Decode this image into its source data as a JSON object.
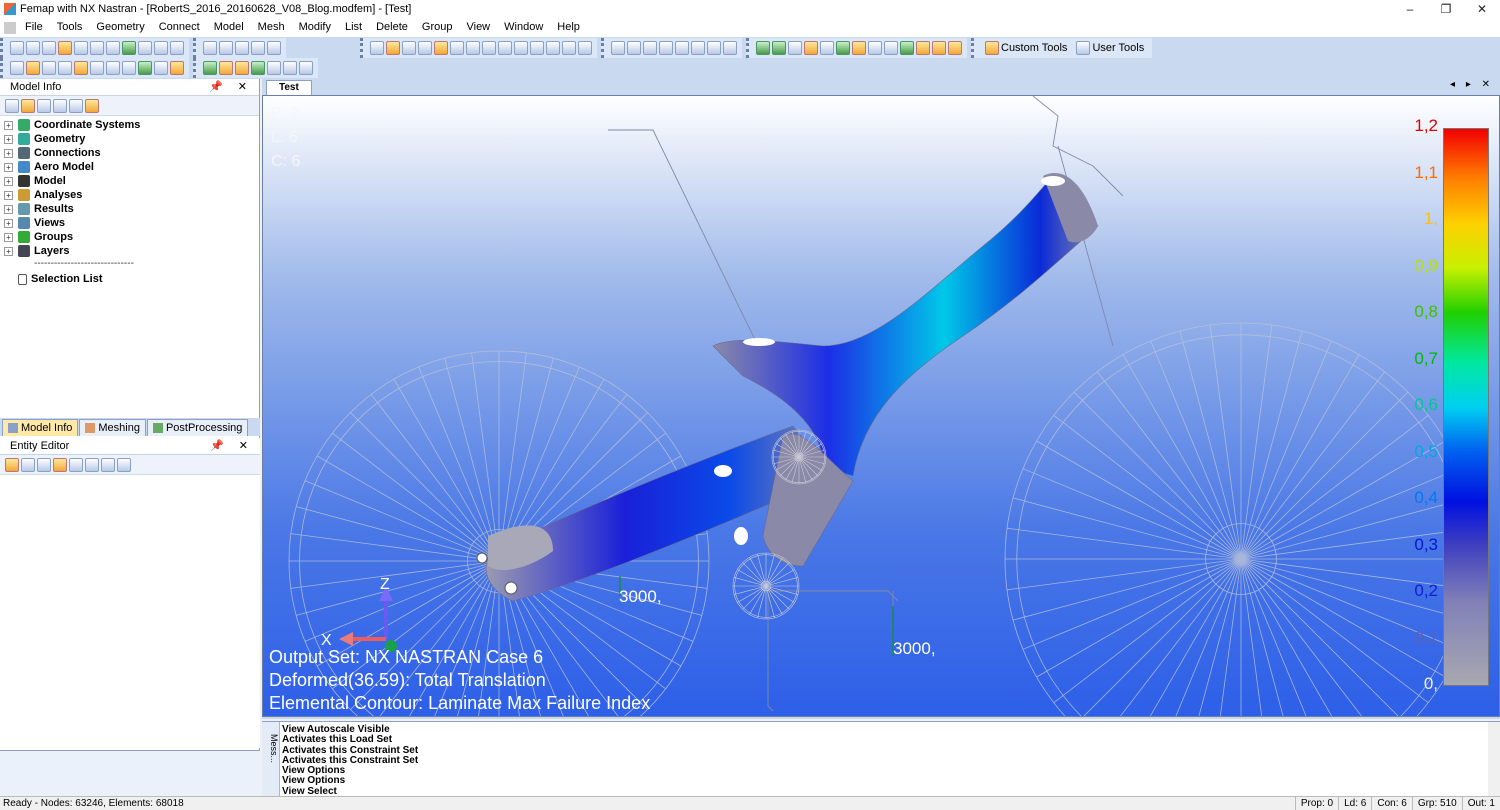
{
  "window": {
    "title": "Femap with NX Nastran - [RobertS_2016_20160628_V08_Blog.modfem] - [Test]",
    "controls": {
      "minimize": "–",
      "maximize": "❐",
      "close": "✕"
    }
  },
  "menu": [
    "File",
    "Tools",
    "Geometry",
    "Connect",
    "Model",
    "Mesh",
    "Modify",
    "List",
    "Delete",
    "Group",
    "View",
    "Window",
    "Help"
  ],
  "toolbar": {
    "custom_tools": "Custom Tools",
    "user_tools": "User Tools"
  },
  "model_info": {
    "title": "Model Info",
    "pane_buttons": "📌 ✕",
    "tree": [
      {
        "label": "Coordinate Systems",
        "color": "#3a6"
      },
      {
        "label": "Geometry",
        "color": "#3a9"
      },
      {
        "label": "Connections",
        "color": "#567"
      },
      {
        "label": "Aero Model",
        "color": "#48c"
      },
      {
        "label": "Model",
        "color": "#333"
      },
      {
        "label": "Analyses",
        "color": "#c93"
      },
      {
        "label": "Results",
        "color": "#69a"
      },
      {
        "label": "Views",
        "color": "#58a"
      },
      {
        "label": "Groups",
        "color": "#3a3"
      },
      {
        "label": "Layers",
        "color": "#445"
      }
    ],
    "separator": "------------------------------",
    "selection_list": "Selection List",
    "expander": "+"
  },
  "left_tabs": [
    "Model Info",
    "Meshing",
    "PostProcessing"
  ],
  "entity_editor": {
    "title": "Entity Editor",
    "pane_buttons": "📌 ✕"
  },
  "doc_tab": "Test",
  "doc_controls": "◂ ▸ ✕",
  "viewport": {
    "info_tl": [
      "P: 2",
      "L: 6",
      "C: 6"
    ],
    "info_bl": [
      "Output Set: NX NASTRAN Case 6",
      "Deformed(36.59): Total Translation",
      "Elemental Contour: Laminate Max Failure Index"
    ],
    "load_labels": [
      "3000,",
      "3000,"
    ],
    "axis_labels": {
      "z": "Z",
      "x": "X"
    },
    "legend": [
      {
        "v": "1,2",
        "color": "#e00000"
      },
      {
        "v": "1,1",
        "color": "#ff6a00"
      },
      {
        "v": "1,",
        "color": "#ffc000"
      },
      {
        "v": "0,9",
        "color": "#b8e000"
      },
      {
        "v": "0,8",
        "color": "#40c000"
      },
      {
        "v": "0,7",
        "color": "#00b800"
      },
      {
        "v": "0,6",
        "color": "#00c890"
      },
      {
        "v": "0,5",
        "color": "#00a8e0"
      },
      {
        "v": "0,4",
        "color": "#0078f0"
      },
      {
        "v": "0,3",
        "color": "#0018d8"
      },
      {
        "v": "0,2",
        "color": "#1020d0"
      },
      {
        "v": "0,1",
        "color": "#6060b0"
      },
      {
        "v": "0,",
        "color": "#f0f0f0"
      }
    ]
  },
  "messages": {
    "side_label": "Mess...",
    "lines": [
      "View Autoscale Visible",
      "Activates this Load Set",
      "Activates this Constraint Set",
      "Activates this Constraint Set",
      "View Options",
      "View Options",
      "View Select"
    ]
  },
  "status": {
    "left": "Ready - Nodes: 63246,  Elements: 68018",
    "right": [
      "Prop: 0",
      "Ld: 6",
      "Con: 6",
      "Grp: 510",
      "Out: 1"
    ]
  }
}
